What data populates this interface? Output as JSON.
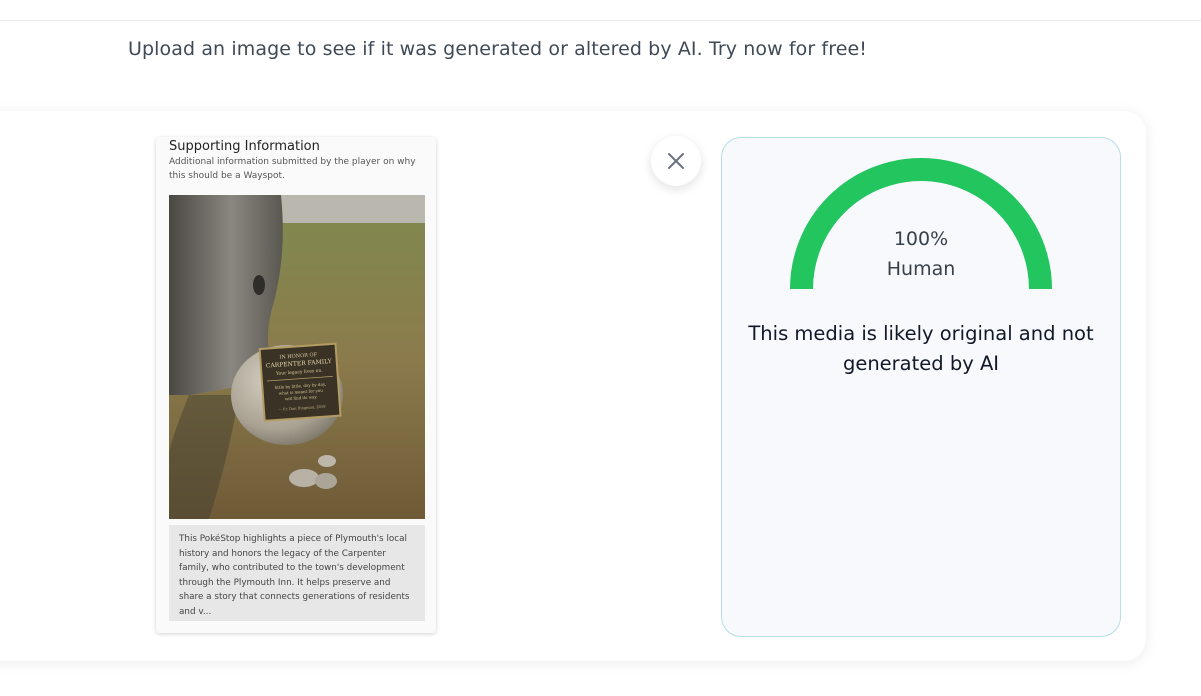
{
  "page": {
    "tagline": "Upload an image to see if it was generated or altered by AI. Try now for free!"
  },
  "upload": {
    "heading": "Supporting Information",
    "subheading": "Additional information submitted by the player on why this should be a Wayspot.",
    "photo": {
      "plaque_line1": "IN HONOR OF",
      "plaque_line2": "CARPENTER FAMILY",
      "plaque_line3": "Your legacy lives on.",
      "plaque_line4": "little by little, day by day,",
      "plaque_line5": "what is meant for you",
      "plaque_line6": "will find its way.",
      "plaque_line7": "— Fr. Dan Dingman, 2019"
    },
    "description": "This PokéStop highlights a piece of Plymouth's local history and honors the legacy of the Carpenter family, who contributed to the town's development through the Plymouth Inn. It helps preserve and share a story that connects generations of residents and v..."
  },
  "close_icon": "close-icon",
  "result": {
    "percent": "100%",
    "label": "Human",
    "score_fraction": 1.0,
    "gauge_color": "#22c55e",
    "verdict": "This media is likely original and not generated by AI"
  }
}
